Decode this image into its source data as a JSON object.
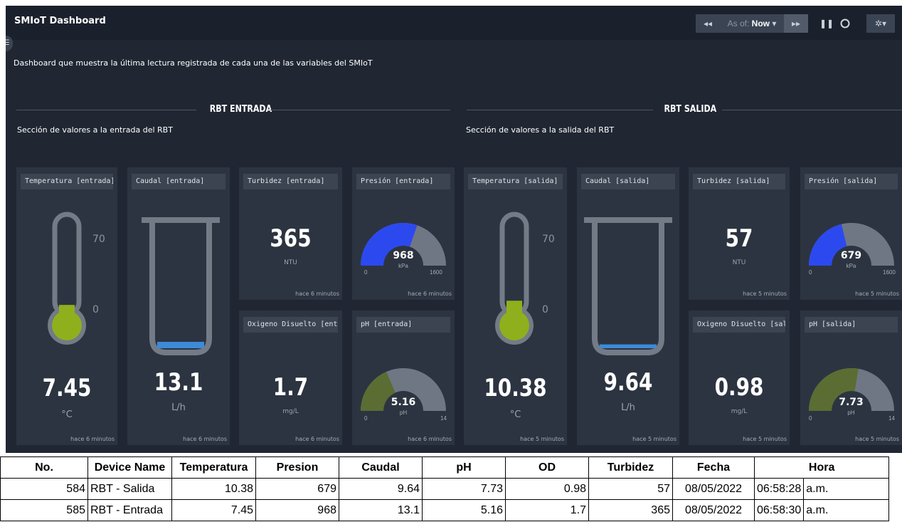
{
  "header": {
    "title": "SMIoT Dashboard",
    "back_icon": "rewind-icon",
    "as_of_label": "As of:",
    "as_of_value": "Now",
    "forward_icon": "fast-forward-icon",
    "pause_icon": "pause-icon",
    "refresh_icon": "circle-icon",
    "settings_icon": "gear-icon"
  },
  "description": "Dashboard que muestra la última lectura registrada de cada una de las variables del SMIoT",
  "sections": [
    {
      "title": "RBT ENTRADA",
      "subtitle": "Sección de valores a la entrada del RBT",
      "panels": {
        "temperatura": {
          "title": "Temperatura [entrada]",
          "value": "7.45",
          "unit": "°C",
          "scale_top": "70",
          "scale_bottom": "0",
          "fill": 0.106,
          "footer": "hace 6 minutos"
        },
        "caudal": {
          "title": "Caudal [entrada]",
          "value": "13.1",
          "unit": "L/h",
          "fill": 0.05,
          "footer": "hace 6 minutos"
        },
        "turbidez": {
          "title": "Turbidez [entrada]",
          "value": "365",
          "unit": "NTU",
          "footer": "hace 6 minutos"
        },
        "presion": {
          "title": "Presión [entrada]",
          "value": "968",
          "unit": "kPa",
          "min": "0",
          "max": "1600",
          "fraction": 0.605,
          "footer": "hace 6 minutos"
        },
        "oxigeno": {
          "title": "Oxigeno Disuelto [entrada]",
          "value": "1.7",
          "unit": "mg/L",
          "footer": "hace 6 minutos"
        },
        "ph": {
          "title": "pH [entrada]",
          "value": "5.16",
          "unit": "pH",
          "min": "0",
          "max": "14",
          "fraction": 0.369,
          "footer": "hace 6 minutos"
        }
      }
    },
    {
      "title": "RBT SALIDA",
      "subtitle": "Sección de valores a la salida del RBT",
      "panels": {
        "temperatura": {
          "title": "Temperatura [salida]",
          "value": "10.38",
          "unit": "°C",
          "scale_top": "70",
          "scale_bottom": "0",
          "fill": 0.148,
          "footer": "hace 5 minutos"
        },
        "caudal": {
          "title": "Caudal [salida]",
          "value": "9.64",
          "unit": "L/h",
          "fill": 0.03,
          "footer": "hace 5 minutos"
        },
        "turbidez": {
          "title": "Turbidez [salida]",
          "value": "57",
          "unit": "NTU",
          "footer": "hace 5 minutos"
        },
        "presion": {
          "title": "Presión [salida]",
          "value": "679",
          "unit": "kPa",
          "min": "0",
          "max": "1600",
          "fraction": 0.424,
          "footer": "hace 5 minutos"
        },
        "oxigeno": {
          "title": "Oxigeno Disuelto [salida]",
          "value": "0.98",
          "unit": "mg/L",
          "footer": "hace 5 minutos"
        },
        "ph": {
          "title": "pH [salida]",
          "value": "7.73",
          "unit": "pH",
          "min": "0",
          "max": "14",
          "fraction": 0.552,
          "footer": "hace 5 minutos"
        }
      }
    }
  ],
  "colors": {
    "pressure": "#2c49f0",
    "ph": "#5b6d32",
    "thermo": "#8fb01c",
    "caudal": "#3d8ad9",
    "track": "#6f7784"
  },
  "table": {
    "headers": [
      "No.",
      "Device Name",
      "Temperatura",
      "Presion",
      "Caudal",
      "pH",
      "OD",
      "Turbidez",
      "Fecha",
      "Hora"
    ],
    "rows": [
      [
        "584",
        "RBT - Salida",
        "10.38",
        "679",
        "9.64",
        "7.73",
        "0.98",
        "57",
        "08/05/2022",
        "06:58:28",
        "a.m."
      ],
      [
        "585",
        "RBT - Entrada",
        "7.45",
        "968",
        "13.1",
        "5.16",
        "1.7",
        "365",
        "08/05/2022",
        "06:58:30",
        "a.m."
      ]
    ]
  }
}
